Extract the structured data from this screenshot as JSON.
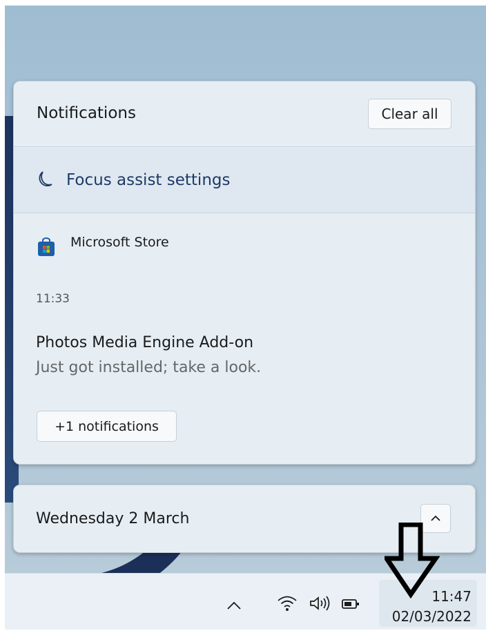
{
  "notification_center": {
    "title": "Notifications",
    "clear_all_label": "Clear all",
    "focus_assist_label": "Focus assist settings",
    "notification": {
      "app_name": "Microsoft Store",
      "time": "11:33",
      "title": "Photos Media Engine Add-on",
      "body": "Just got installed; take a look."
    },
    "more_label": "+1 notifications"
  },
  "calendar": {
    "date_label": "Wednesday 2 March"
  },
  "taskbar": {
    "time": "11:47",
    "date": "02/03/2022",
    "icons": [
      "chevron-up-icon",
      "wifi-icon",
      "volume-icon",
      "battery-icon"
    ]
  },
  "colors": {
    "panel_bg": "#e6eef4",
    "focus_text": "#1f3a68",
    "annotation_arrow": "#000000"
  }
}
